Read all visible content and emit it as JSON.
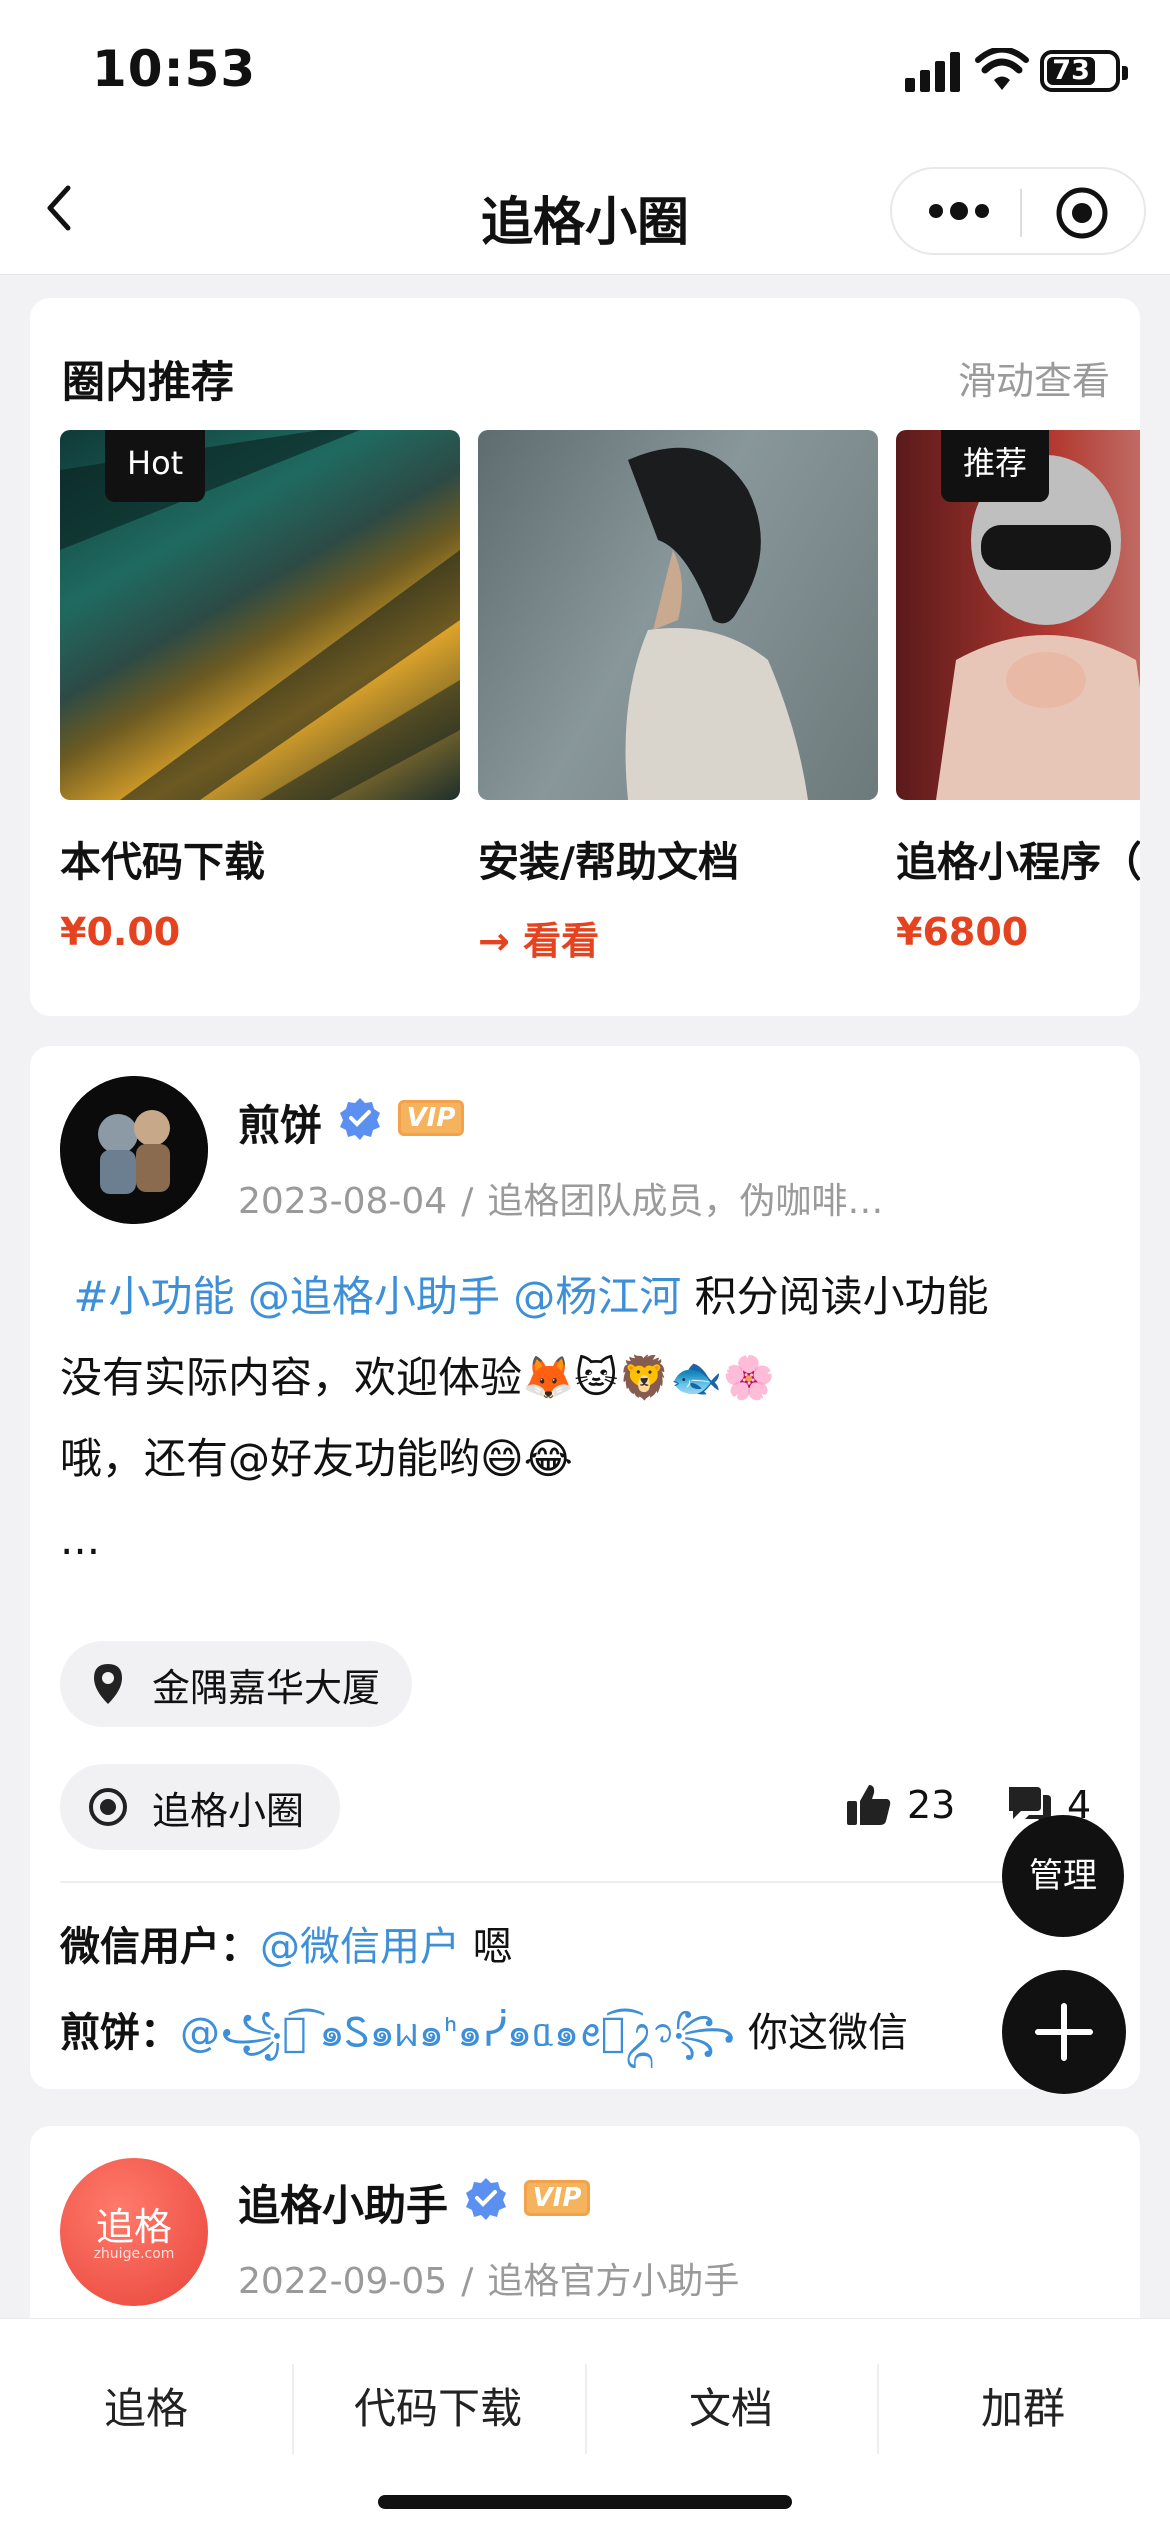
{
  "status_bar": {
    "time": "10:53",
    "battery": "73"
  },
  "nav": {
    "title": "追格小圈"
  },
  "recommend": {
    "title": "圈内推荐",
    "hint": "滑动查看",
    "items": [
      {
        "tag": "Hot",
        "name": "本代码下载",
        "price": "¥0.00"
      },
      {
        "tag": "",
        "name": "安装/帮助文档",
        "price": "→ 看看"
      },
      {
        "tag": "推荐",
        "name": "追格小程序（",
        "price": "¥6800"
      }
    ]
  },
  "post1": {
    "author": "煎饼",
    "vip": "VIP",
    "date": "2023-08-04",
    "meta_sep": "/",
    "bio": "追格团队成员，伪咖啡…",
    "body": {
      "tag1": "#小功能",
      "mention1": "@追格小助手",
      "mention2": "@杨江河",
      "text1": "积分阅读小功能",
      "line2": "没有实际内容，欢迎体验🦊🐱🦁🐟🌸",
      "line3": "哦，还有@好友功能哟😄😂",
      "line4": "..."
    },
    "location": "金隅嘉华大厦",
    "circle": "追格小圈",
    "likes": "23",
    "comments": "4",
    "comment_list": [
      {
        "user": "微信用户：",
        "mention": "@微信用户",
        "text": "嗯"
      },
      {
        "user": "煎饼：",
        "mention": "@꧁ᬊ͡ ๑Ꮪ๑ᥕ๑ᑋ๑ᓰ๑ᥲ๑ꫀ๑͡ᬊ꧂",
        "text": "你这微信"
      }
    ]
  },
  "post2": {
    "author": "追格小助手",
    "vip": "VIP",
    "avatar_text": "追格",
    "avatar_sub": "zhuige.com",
    "date": "2022-09-05",
    "meta_sep": "/",
    "bio": "追格官方小助手"
  },
  "fab": {
    "manage": "管理"
  },
  "tabbar": {
    "items": [
      "追格",
      "代码下载",
      "文档",
      "加群"
    ]
  },
  "colors": {
    "accent_red": "#e5431f",
    "link_blue": "#3d8fd8",
    "vip_orange": "#f5b35d",
    "verified_blue": "#5b8ff0"
  }
}
